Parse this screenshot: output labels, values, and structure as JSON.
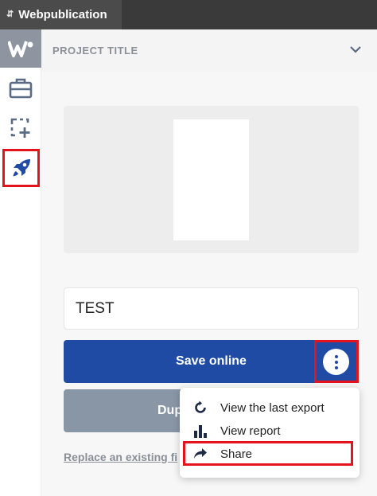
{
  "app": {
    "tab_title": "Webpublication"
  },
  "panel": {
    "header_title": "PROJECT TITLE"
  },
  "form": {
    "project_name_value": "TEST"
  },
  "actions": {
    "save_label": "Save online",
    "duplicate_label_visible": "Dup",
    "replace_link_visible": "Replace an existing fi"
  },
  "menu": {
    "items": [
      {
        "label": "View the last export",
        "icon": "refresh-icon"
      },
      {
        "label": "View report",
        "icon": "bar-chart-icon"
      },
      {
        "label": "Share",
        "icon": "share-arrow-icon"
      }
    ]
  },
  "colors": {
    "brand_blue": "#1f4ba5",
    "highlight_red": "#e5131d",
    "disabled_button": "#8996a6",
    "topbar": "#3a3a3a"
  }
}
